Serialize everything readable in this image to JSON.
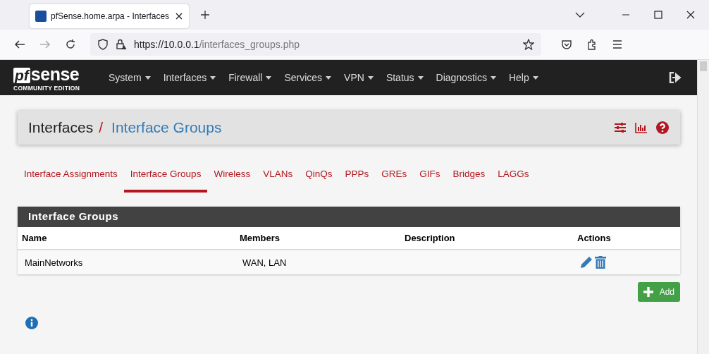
{
  "browser": {
    "tab_title": "pfSense.home.arpa - Interfaces",
    "url_host": "https://10.0.0.1",
    "url_path": "/interfaces_groups.php"
  },
  "navbar": {
    "logo": "sense",
    "logo_prefix": "pf",
    "edition": "COMMUNITY EDITION",
    "menus": [
      "System",
      "Interfaces",
      "Firewall",
      "Services",
      "VPN",
      "Status",
      "Diagnostics",
      "Help"
    ]
  },
  "breadcrumb": {
    "parent": "Interfaces",
    "separator": "/",
    "current": "Interface Groups"
  },
  "tabs": [
    {
      "label": "Interface Assignments",
      "selected": false
    },
    {
      "label": "Interface Groups",
      "selected": true
    },
    {
      "label": "Wireless",
      "selected": false
    },
    {
      "label": "VLANs",
      "selected": false
    },
    {
      "label": "QinQs",
      "selected": false
    },
    {
      "label": "PPPs",
      "selected": false
    },
    {
      "label": "GREs",
      "selected": false
    },
    {
      "label": "GIFs",
      "selected": false
    },
    {
      "label": "Bridges",
      "selected": false
    },
    {
      "label": "LAGGs",
      "selected": false
    }
  ],
  "panel": {
    "title": "Interface Groups",
    "columns": [
      "Name",
      "Members",
      "Description",
      "Actions"
    ],
    "rows": [
      {
        "name": "MainNetworks",
        "members": "WAN, LAN"
      }
    ]
  },
  "add_button": "Add"
}
